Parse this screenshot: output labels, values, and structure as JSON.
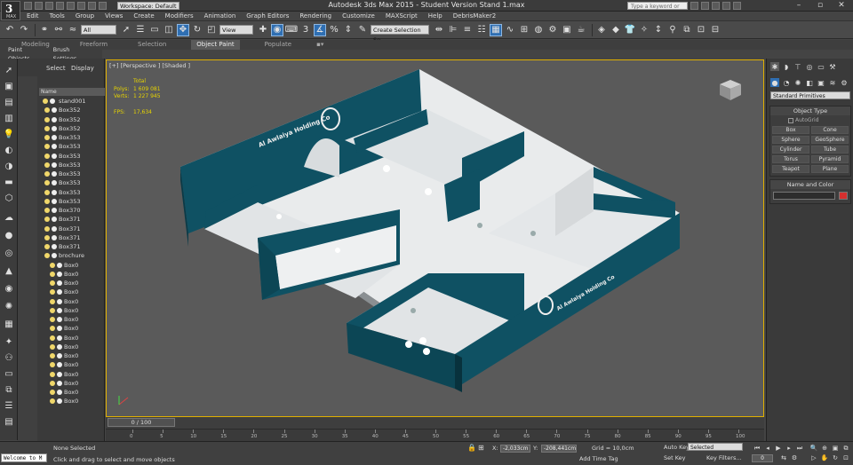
{
  "titlebar": {
    "workspace": "Workspace: Default",
    "title": "Autodesk 3ds Max  2015   - Student Version     Stand 1.max",
    "search_placeholder": "Type a keyword or phrase",
    "app_label": "MAX"
  },
  "menu": {
    "items": [
      "Edit",
      "Tools",
      "Group",
      "Views",
      "Create",
      "Modifiers",
      "Animation",
      "Graph Editors",
      "Rendering",
      "Customize",
      "MAXScript",
      "Help",
      "DebrisMaker2"
    ]
  },
  "toolbar": {
    "selection_filter": "All",
    "ref_coord": "View",
    "named_selection": "Create Selection Se"
  },
  "ribbon": {
    "tabs": [
      "Modeling",
      "Freeform",
      "Selection",
      "Object Paint",
      "Populate"
    ],
    "active_tab": "Object Paint",
    "sub": [
      "Paint Objects",
      "Brush Settings"
    ]
  },
  "explorer": {
    "tabs": [
      "Select",
      "Display"
    ],
    "name_header": "Name",
    "root": "stand001",
    "items": [
      "Box352",
      "Box352",
      "Box352",
      "Box353",
      "Box353",
      "Box353",
      "Box353",
      "Box353",
      "Box353",
      "Box353",
      "Box353",
      "Box370",
      "Box371",
      "Box371",
      "Box371",
      "Box371",
      "brochure",
      "Box0",
      "Box0",
      "Box0",
      "Box0",
      "Box0",
      "Box0",
      "Box0",
      "Box0",
      "Box0",
      "Box0",
      "Box0",
      "Box0",
      "Box0",
      "Box0",
      "Box0",
      "Box0"
    ]
  },
  "viewport": {
    "label": "[+] [Perspective ] [Shaded ]",
    "stats": {
      "total_label": "Total",
      "polys_label": "Polys:",
      "polys": "1 609 081",
      "verts_label": "Verts:",
      "verts": "1 227 945",
      "fps_label": "FPS:",
      "fps": "17,634"
    },
    "sign_text": "Al Awlaiya Holding Co",
    "sign_text_2": "Al Awlaiya Holding Co"
  },
  "command_panel": {
    "primitive_type": "Standard Primitives",
    "object_type_header": "Object Type",
    "autogrid": "AutoGrid",
    "buttons": [
      "Box",
      "Cone",
      "Sphere",
      "GeoSphere",
      "Cylinder",
      "Tube",
      "Torus",
      "Pyramid",
      "Teapot",
      "Plane"
    ],
    "name_color_header": "Name and Color"
  },
  "timeline": {
    "slider": "0 / 100",
    "ticks": [
      "0",
      "5",
      "10",
      "15",
      "20",
      "25",
      "30",
      "35",
      "40",
      "45",
      "50",
      "55",
      "60",
      "65",
      "70",
      "75",
      "80",
      "85",
      "90",
      "95",
      "100"
    ]
  },
  "status": {
    "maxscript": "Welcome to M",
    "selection": "None Selected",
    "prompt": "Click and drag to select and move objects",
    "x_label": "X:",
    "x": "-2,033cm",
    "y_label": "Y:",
    "y": "-208,441cm",
    "z_label": "Z:",
    "z": "0,0cm",
    "grid": "Grid = 10,0cm",
    "add_time_tag": "Add Time Tag",
    "auto_key": "Auto Key",
    "key_mode": "Selected",
    "set_key": "Set Key",
    "key_filters": "Key Filters...",
    "frame": "0"
  },
  "colors": {
    "viewport_bg": "#5a5a5a",
    "teal_wall": "#0f5163",
    "floor": "#e9ebec",
    "active_border": "#e0b000",
    "selected_tool": "#2f6fb3",
    "stats": "#e7d400"
  }
}
